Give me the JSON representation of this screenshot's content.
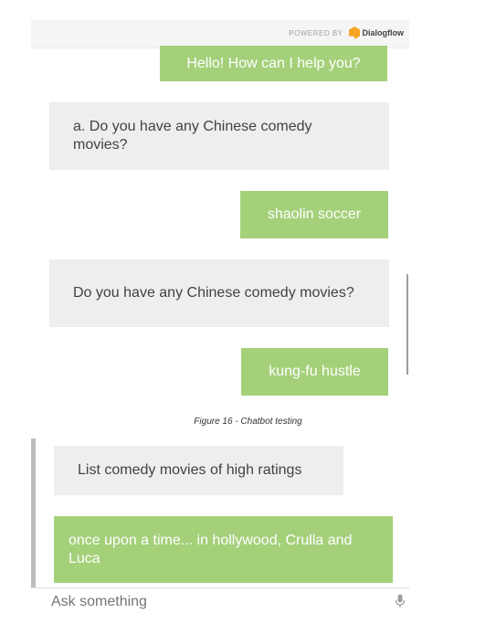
{
  "powered_by": {
    "prefix": "POWERED BY",
    "brand": "Dialogflow",
    "brand_color": "#f5a623"
  },
  "colors": {
    "user_bubble": "#a4d07a",
    "bot_bubble": "#eeeeee"
  },
  "chat_top": {
    "messages": [
      {
        "role": "user",
        "text": "Hello! How can I help you?"
      },
      {
        "role": "bot",
        "text": "a. Do you have any Chinese comedy movies?"
      },
      {
        "role": "user",
        "text": "shaolin soccer"
      },
      {
        "role": "bot",
        "text": "Do you have any Chinese comedy movies?"
      },
      {
        "role": "user",
        "text": "kung-fu hustle"
      }
    ]
  },
  "caption": "Figure 16 - Chatbot testing",
  "chat_bottom": {
    "messages": [
      {
        "role": "bot",
        "text": "List comedy movies of high ratings"
      },
      {
        "role": "user",
        "text": "once upon a time... in hollywood, Crulla and Luca"
      }
    ]
  },
  "input": {
    "placeholder": "Ask something",
    "mic_icon": "microphone-icon"
  }
}
